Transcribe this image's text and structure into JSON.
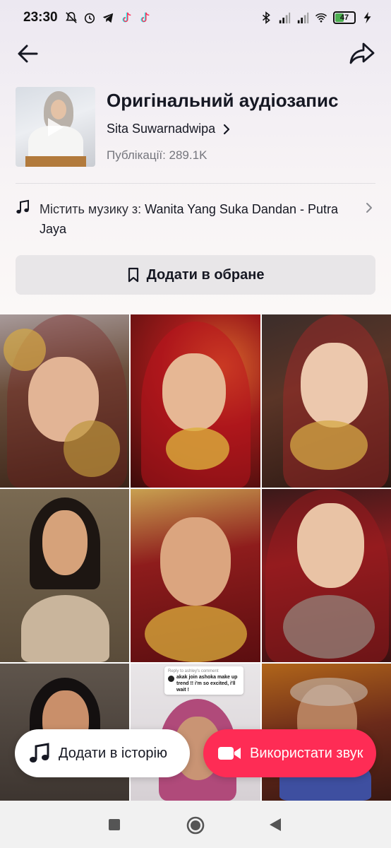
{
  "status_bar": {
    "time": "23:30",
    "battery": "47",
    "battery_level": 0.47,
    "icons_left": [
      "bell-off-icon",
      "alarm-icon",
      "telegram-icon",
      "tiktok-icon",
      "tiktok-icon"
    ],
    "icons_right": [
      "bluetooth-icon",
      "signal-icon",
      "signal-icon",
      "wifi-icon",
      "battery-icon",
      "charging-icon"
    ]
  },
  "sound": {
    "title": "Оригінальний аудіозапис",
    "author": "Sita Suwarnadwipa",
    "posts": "Публікації: 289.1K",
    "music_prefix": "Містить музику з:",
    "music_name": "Wanita Yang Suka Dandan - Putra Jaya",
    "favorite_label": "Додати в обране"
  },
  "grid": {
    "comment": {
      "reply": "Reply to ashley's comment",
      "text": "akak join ashoka make up trend !! i'm so excited, i'll wait !"
    }
  },
  "actions": {
    "story_label": "Додати в історію",
    "use_sound_label": "Використати звук"
  },
  "colors": {
    "accent": "#fe2c55",
    "text": "#161823",
    "secondary_text": "#75767d"
  }
}
